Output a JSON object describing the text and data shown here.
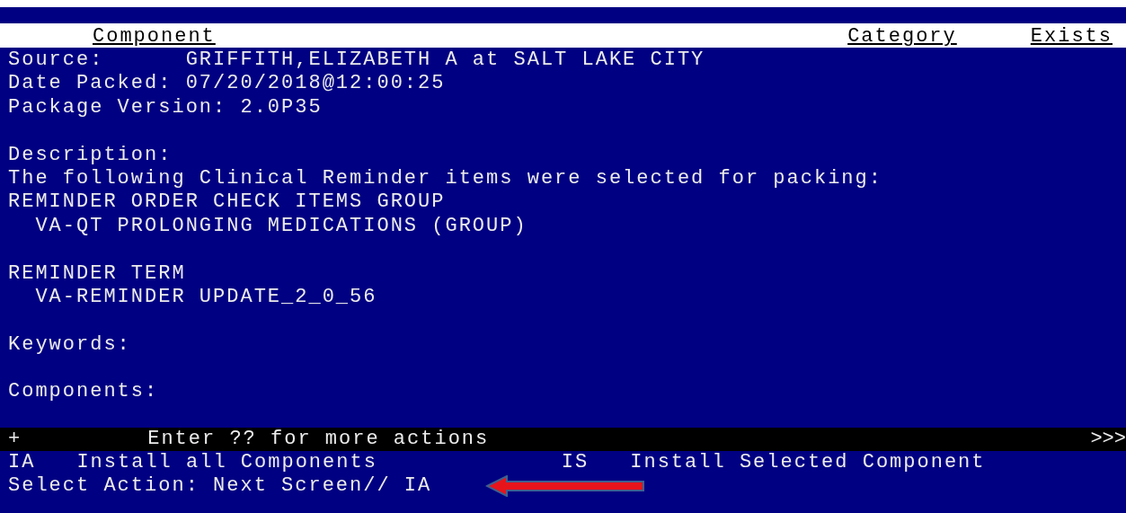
{
  "header": {
    "columns": [
      "Component",
      "Category",
      "Exists"
    ]
  },
  "blocks": [
    {
      "lines": [
        "Source:      GRIFFITH,ELIZABETH A at SALT LAKE CITY",
        "Date Packed: 07/20/2018@12:00:25",
        "Package Version: 2.0P35"
      ]
    },
    {
      "lines": [
        "Description:",
        "The following Clinical Reminder items were selected for packing:",
        "REMINDER ORDER CHECK ITEMS GROUP",
        "  VA-QT PROLONGING MEDICATIONS (GROUP)"
      ]
    },
    {
      "lines": [
        "REMINDER TERM",
        "  VA-REMINDER UPDATE_2_0_56"
      ]
    },
    {
      "lines": [
        "Keywords:"
      ]
    },
    {
      "lines": [
        "Components:"
      ]
    }
  ],
  "action_bar": {
    "marker": "+",
    "hint": "Enter ?? for more actions",
    "more": ">>>"
  },
  "actions": [
    {
      "code": "IA",
      "label": "Install all Components"
    },
    {
      "code": "IS",
      "label": "Install Selected Component"
    }
  ],
  "prompt": "Select Action: Next Screen// IA"
}
